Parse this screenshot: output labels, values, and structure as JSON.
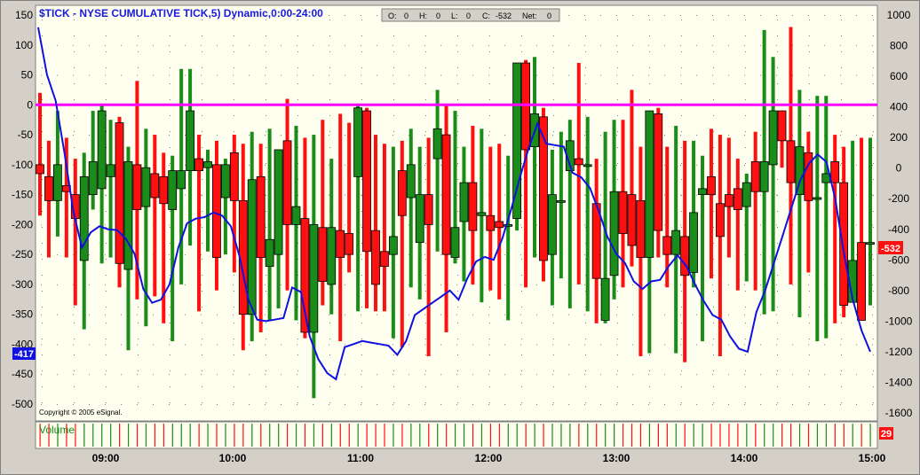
{
  "title": "$TICK - NYSE CUMULATIVE TICK,5) Dynamic,0:00-24:00",
  "ohlc_box": {
    "o_label": "O:",
    "o_value": "0",
    "h_label": "H:",
    "h_value": "0",
    "l_label": "L:",
    "l_value": "0",
    "c_label": "C:",
    "c_value": "-532",
    "net_label": "Net:",
    "net_value": "0"
  },
  "copyright": "Copyright © 2005 eSignal.",
  "volume_label": "Volume",
  "badges": {
    "left_value": "-417",
    "right_value": "-532",
    "volume_value": "29"
  },
  "colors": {
    "up": "#1a8c1a",
    "down": "#ff1010",
    "cumulative_line": "#1010e0",
    "zero_line": "#ff00ff",
    "background": "#fffff0"
  },
  "chart_data": {
    "type": "candlestick",
    "x_ticks": [
      "09:00",
      "10:00",
      "11:00",
      "12:00",
      "13:00",
      "14:00",
      "15:00"
    ],
    "left_axis": {
      "ticks": [
        150,
        100,
        50,
        0,
        -50,
        -100,
        -150,
        -200,
        -250,
        -300,
        -350,
        -400,
        -450,
        -500
      ],
      "ylim": [
        -510,
        160
      ]
    },
    "right_axis": {
      "ticks": [
        1000,
        800,
        600,
        400,
        200,
        0,
        -200,
        -400,
        -600,
        -800,
        -1000,
        -1200,
        -1400,
        -1600
      ],
      "ylim": [
        -1620,
        1020
      ]
    },
    "reference_line": {
      "axis": "left",
      "value": 0
    },
    "candles": [
      {
        "o": -100,
        "h": 20,
        "l": -185,
        "c": -115
      },
      {
        "o": -120,
        "h": -60,
        "l": -255,
        "c": -160
      },
      {
        "o": -160,
        "h": -10,
        "l": -220,
        "c": -100
      },
      {
        "o": -135,
        "h": -55,
        "l": -255,
        "c": -145
      },
      {
        "o": -150,
        "h": -90,
        "l": -335,
        "c": -190
      },
      {
        "o": -260,
        "h": -80,
        "l": -375,
        "c": -120
      },
      {
        "o": -150,
        "h": -10,
        "l": -175,
        "c": -95
      },
      {
        "o": -140,
        "h": 0,
        "l": -265,
        "c": -10
      },
      {
        "o": -120,
        "h": -25,
        "l": -255,
        "c": -100
      },
      {
        "o": -30,
        "h": -20,
        "l": -305,
        "c": -265
      },
      {
        "o": -275,
        "h": -70,
        "l": -410,
        "c": -95
      },
      {
        "o": -100,
        "h": 40,
        "l": -325,
        "c": -175
      },
      {
        "o": -170,
        "h": -40,
        "l": -370,
        "c": -105
      },
      {
        "o": -115,
        "h": -50,
        "l": -320,
        "c": -155
      },
      {
        "o": -120,
        "h": -80,
        "l": -365,
        "c": -165
      },
      {
        "o": -175,
        "h": -85,
        "l": -395,
        "c": -110
      },
      {
        "o": -140,
        "h": 60,
        "l": -300,
        "c": -110
      },
      {
        "o": -110,
        "h": 60,
        "l": -235,
        "c": -10
      },
      {
        "o": -90,
        "h": -50,
        "l": -345,
        "c": -110
      },
      {
        "o": -105,
        "h": -75,
        "l": -245,
        "c": -95
      },
      {
        "o": -100,
        "h": -60,
        "l": -310,
        "c": -255
      },
      {
        "o": -155,
        "h": -90,
        "l": -250,
        "c": -100
      },
      {
        "o": -80,
        "h": -50,
        "l": -280,
        "c": -160
      },
      {
        "o": -160,
        "h": -65,
        "l": -410,
        "c": -350
      },
      {
        "o": -350,
        "h": -45,
        "l": -395,
        "c": -125
      },
      {
        "o": -120,
        "h": -65,
        "l": -380,
        "c": -255
      },
      {
        "o": -270,
        "h": -40,
        "l": -360,
        "c": -225
      },
      {
        "o": -250,
        "h": -75,
        "l": -340,
        "c": -75
      },
      {
        "o": -60,
        "h": 10,
        "l": -310,
        "c": -200
      },
      {
        "o": -200,
        "h": -35,
        "l": -360,
        "c": -170
      },
      {
        "o": -190,
        "h": -55,
        "l": -390,
        "c": -380
      },
      {
        "o": -380,
        "h": -50,
        "l": -490,
        "c": -200
      },
      {
        "o": -205,
        "h": -25,
        "l": -335,
        "c": -295
      },
      {
        "o": -300,
        "h": -90,
        "l": -350,
        "c": -205
      },
      {
        "o": -210,
        "h": -15,
        "l": -395,
        "c": -255
      },
      {
        "o": -215,
        "h": -30,
        "l": -280,
        "c": -250
      },
      {
        "o": -120,
        "h": 0,
        "l": -345,
        "c": -5
      },
      {
        "o": -10,
        "h": -5,
        "l": -340,
        "c": -245
      },
      {
        "o": -210,
        "h": -50,
        "l": -345,
        "c": -300
      },
      {
        "o": -245,
        "h": -65,
        "l": -345,
        "c": -270
      },
      {
        "o": -250,
        "h": -70,
        "l": -390,
        "c": -220
      },
      {
        "o": -110,
        "h": -60,
        "l": -405,
        "c": -185
      },
      {
        "o": -155,
        "h": -40,
        "l": -305,
        "c": -100
      },
      {
        "o": -230,
        "h": -70,
        "l": -325,
        "c": -150
      },
      {
        "o": -150,
        "h": -55,
        "l": -420,
        "c": -200
      },
      {
        "o": -90,
        "h": 25,
        "l": -245,
        "c": -40
      },
      {
        "o": -50,
        "h": 0,
        "l": -380,
        "c": -250
      },
      {
        "o": -255,
        "h": -10,
        "l": -265,
        "c": -205
      },
      {
        "o": -195,
        "h": -70,
        "l": -295,
        "c": -130
      },
      {
        "o": -130,
        "h": -35,
        "l": -300,
        "c": -210
      },
      {
        "o": -185,
        "h": -40,
        "l": -330,
        "c": -180
      },
      {
        "o": -185,
        "h": -70,
        "l": -310,
        "c": -210
      },
      {
        "o": -195,
        "h": -65,
        "l": -325,
        "c": -205
      },
      {
        "o": -200,
        "h": -85,
        "l": -360,
        "c": -200
      },
      {
        "o": -190,
        "h": 65,
        "l": -210,
        "c": 70
      },
      {
        "o": 70,
        "h": 75,
        "l": -305,
        "c": -75
      },
      {
        "o": -70,
        "h": 80,
        "l": -255,
        "c": -15
      },
      {
        "o": -20,
        "h": -5,
        "l": -295,
        "c": -260
      },
      {
        "o": -250,
        "h": -75,
        "l": -335,
        "c": -150
      },
      {
        "o": -160,
        "h": -45,
        "l": -290,
        "c": -160
      },
      {
        "o": -110,
        "h": -25,
        "l": -340,
        "c": -60
      },
      {
        "o": -90,
        "h": 70,
        "l": -300,
        "c": -100
      },
      {
        "o": -100,
        "h": -20,
        "l": -345,
        "c": -100
      },
      {
        "o": -165,
        "h": -90,
        "l": -365,
        "c": -290
      },
      {
        "o": -360,
        "h": -45,
        "l": -365,
        "c": -290
      },
      {
        "o": -285,
        "h": -25,
        "l": -325,
        "c": -145
      },
      {
        "o": -145,
        "h": -25,
        "l": -305,
        "c": -215
      },
      {
        "o": -150,
        "h": 25,
        "l": -270,
        "c": -235
      },
      {
        "o": -160,
        "h": -70,
        "l": -420,
        "c": -255
      },
      {
        "o": -255,
        "h": -25,
        "l": -415,
        "c": -10
      },
      {
        "o": -15,
        "h": -5,
        "l": -255,
        "c": -210
      },
      {
        "o": -220,
        "h": -70,
        "l": -305,
        "c": -250
      },
      {
        "o": -250,
        "h": -35,
        "l": -415,
        "c": -210
      },
      {
        "o": -220,
        "h": -60,
        "l": -430,
        "c": -285
      },
      {
        "o": -280,
        "h": -60,
        "l": -305,
        "c": -180
      },
      {
        "o": -150,
        "h": -85,
        "l": -395,
        "c": -140
      },
      {
        "o": -120,
        "h": -40,
        "l": -290,
        "c": -150
      },
      {
        "o": -165,
        "h": -50,
        "l": -420,
        "c": -220
      },
      {
        "o": -150,
        "h": -55,
        "l": -255,
        "c": -170
      },
      {
        "o": -140,
        "h": -90,
        "l": -310,
        "c": -175
      },
      {
        "o": -170,
        "h": -115,
        "l": -295,
        "c": -130
      },
      {
        "o": -95,
        "h": -45,
        "l": -310,
        "c": -145
      },
      {
        "o": -145,
        "h": 125,
        "l": -350,
        "c": -95
      },
      {
        "o": -100,
        "h": 80,
        "l": -345,
        "c": -10
      },
      {
        "o": -10,
        "h": -55,
        "l": -105,
        "c": -60
      },
      {
        "o": -60,
        "h": 130,
        "l": -300,
        "c": -130
      },
      {
        "o": -150,
        "h": 25,
        "l": -355,
        "c": -70
      },
      {
        "o": -80,
        "h": -45,
        "l": -280,
        "c": -160
      },
      {
        "o": -155,
        "h": 15,
        "l": -395,
        "c": -155
      },
      {
        "o": -130,
        "h": 15,
        "l": -390,
        "c": -115
      },
      {
        "o": -95,
        "h": -50,
        "l": -365,
        "c": -130
      },
      {
        "o": -130,
        "h": -70,
        "l": -355,
        "c": -335
      },
      {
        "o": -330,
        "h": -60,
        "l": -300,
        "c": -260
      },
      {
        "o": -230,
        "h": -55,
        "l": -350,
        "c": -360
      },
      {
        "o": -230,
        "h": -55,
        "l": -335,
        "c": -230
      }
    ],
    "cumulative_line": {
      "axis": "right",
      "values": [
        920,
        610,
        440,
        100,
        -280,
        -520,
        -420,
        -380,
        -400,
        -405,
        -460,
        -560,
        -790,
        -880,
        -860,
        -760,
        -520,
        -360,
        -330,
        -320,
        -290,
        -310,
        -380,
        -580,
        -860,
        -990,
        -1000,
        -990,
        -980,
        -780,
        -810,
        -1100,
        -1250,
        -1340,
        -1380,
        -1170,
        -1150,
        -1130,
        -1140,
        -1150,
        -1160,
        -1220,
        -1130,
        -960,
        -920,
        -880,
        -840,
        -800,
        -860,
        -720,
        -610,
        -580,
        -600,
        -460,
        -270,
        -60,
        130,
        290,
        160,
        150,
        140,
        -30,
        -60,
        -130,
        -280,
        -450,
        -560,
        -620,
        -740,
        -790,
        -740,
        -730,
        -640,
        -570,
        -640,
        -760,
        -870,
        -960,
        -990,
        -1100,
        -1180,
        -1200,
        -940,
        -800,
        -620,
        -440,
        -260,
        -80,
        30,
        90,
        40,
        -200,
        -560,
        -860,
        -1060,
        -1200
      ]
    },
    "volume": {
      "value": 29
    }
  }
}
